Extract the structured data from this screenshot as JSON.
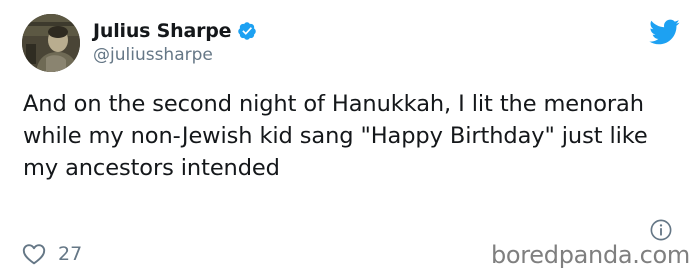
{
  "tweet": {
    "author": {
      "display_name": "Julius Sharpe",
      "handle": "@juliussharpe",
      "verified": true,
      "avatar_icon": "user-avatar-photo"
    },
    "text": "And on the second night of Hanukkah, I lit the menorah while my non-Jewish kid sang \"Happy Birthday\" just like my ancestors intended",
    "likes": "27",
    "icons": {
      "brand": "twitter-bird-icon",
      "verified": "verified-badge-icon",
      "info": "info-icon",
      "like": "heart-icon"
    }
  },
  "watermark": "boredpanda.com",
  "colors": {
    "twitter_blue": "#1da1f2",
    "text_primary": "#14171a",
    "text_secondary": "#657786",
    "watermark": "#7f7f7f"
  }
}
